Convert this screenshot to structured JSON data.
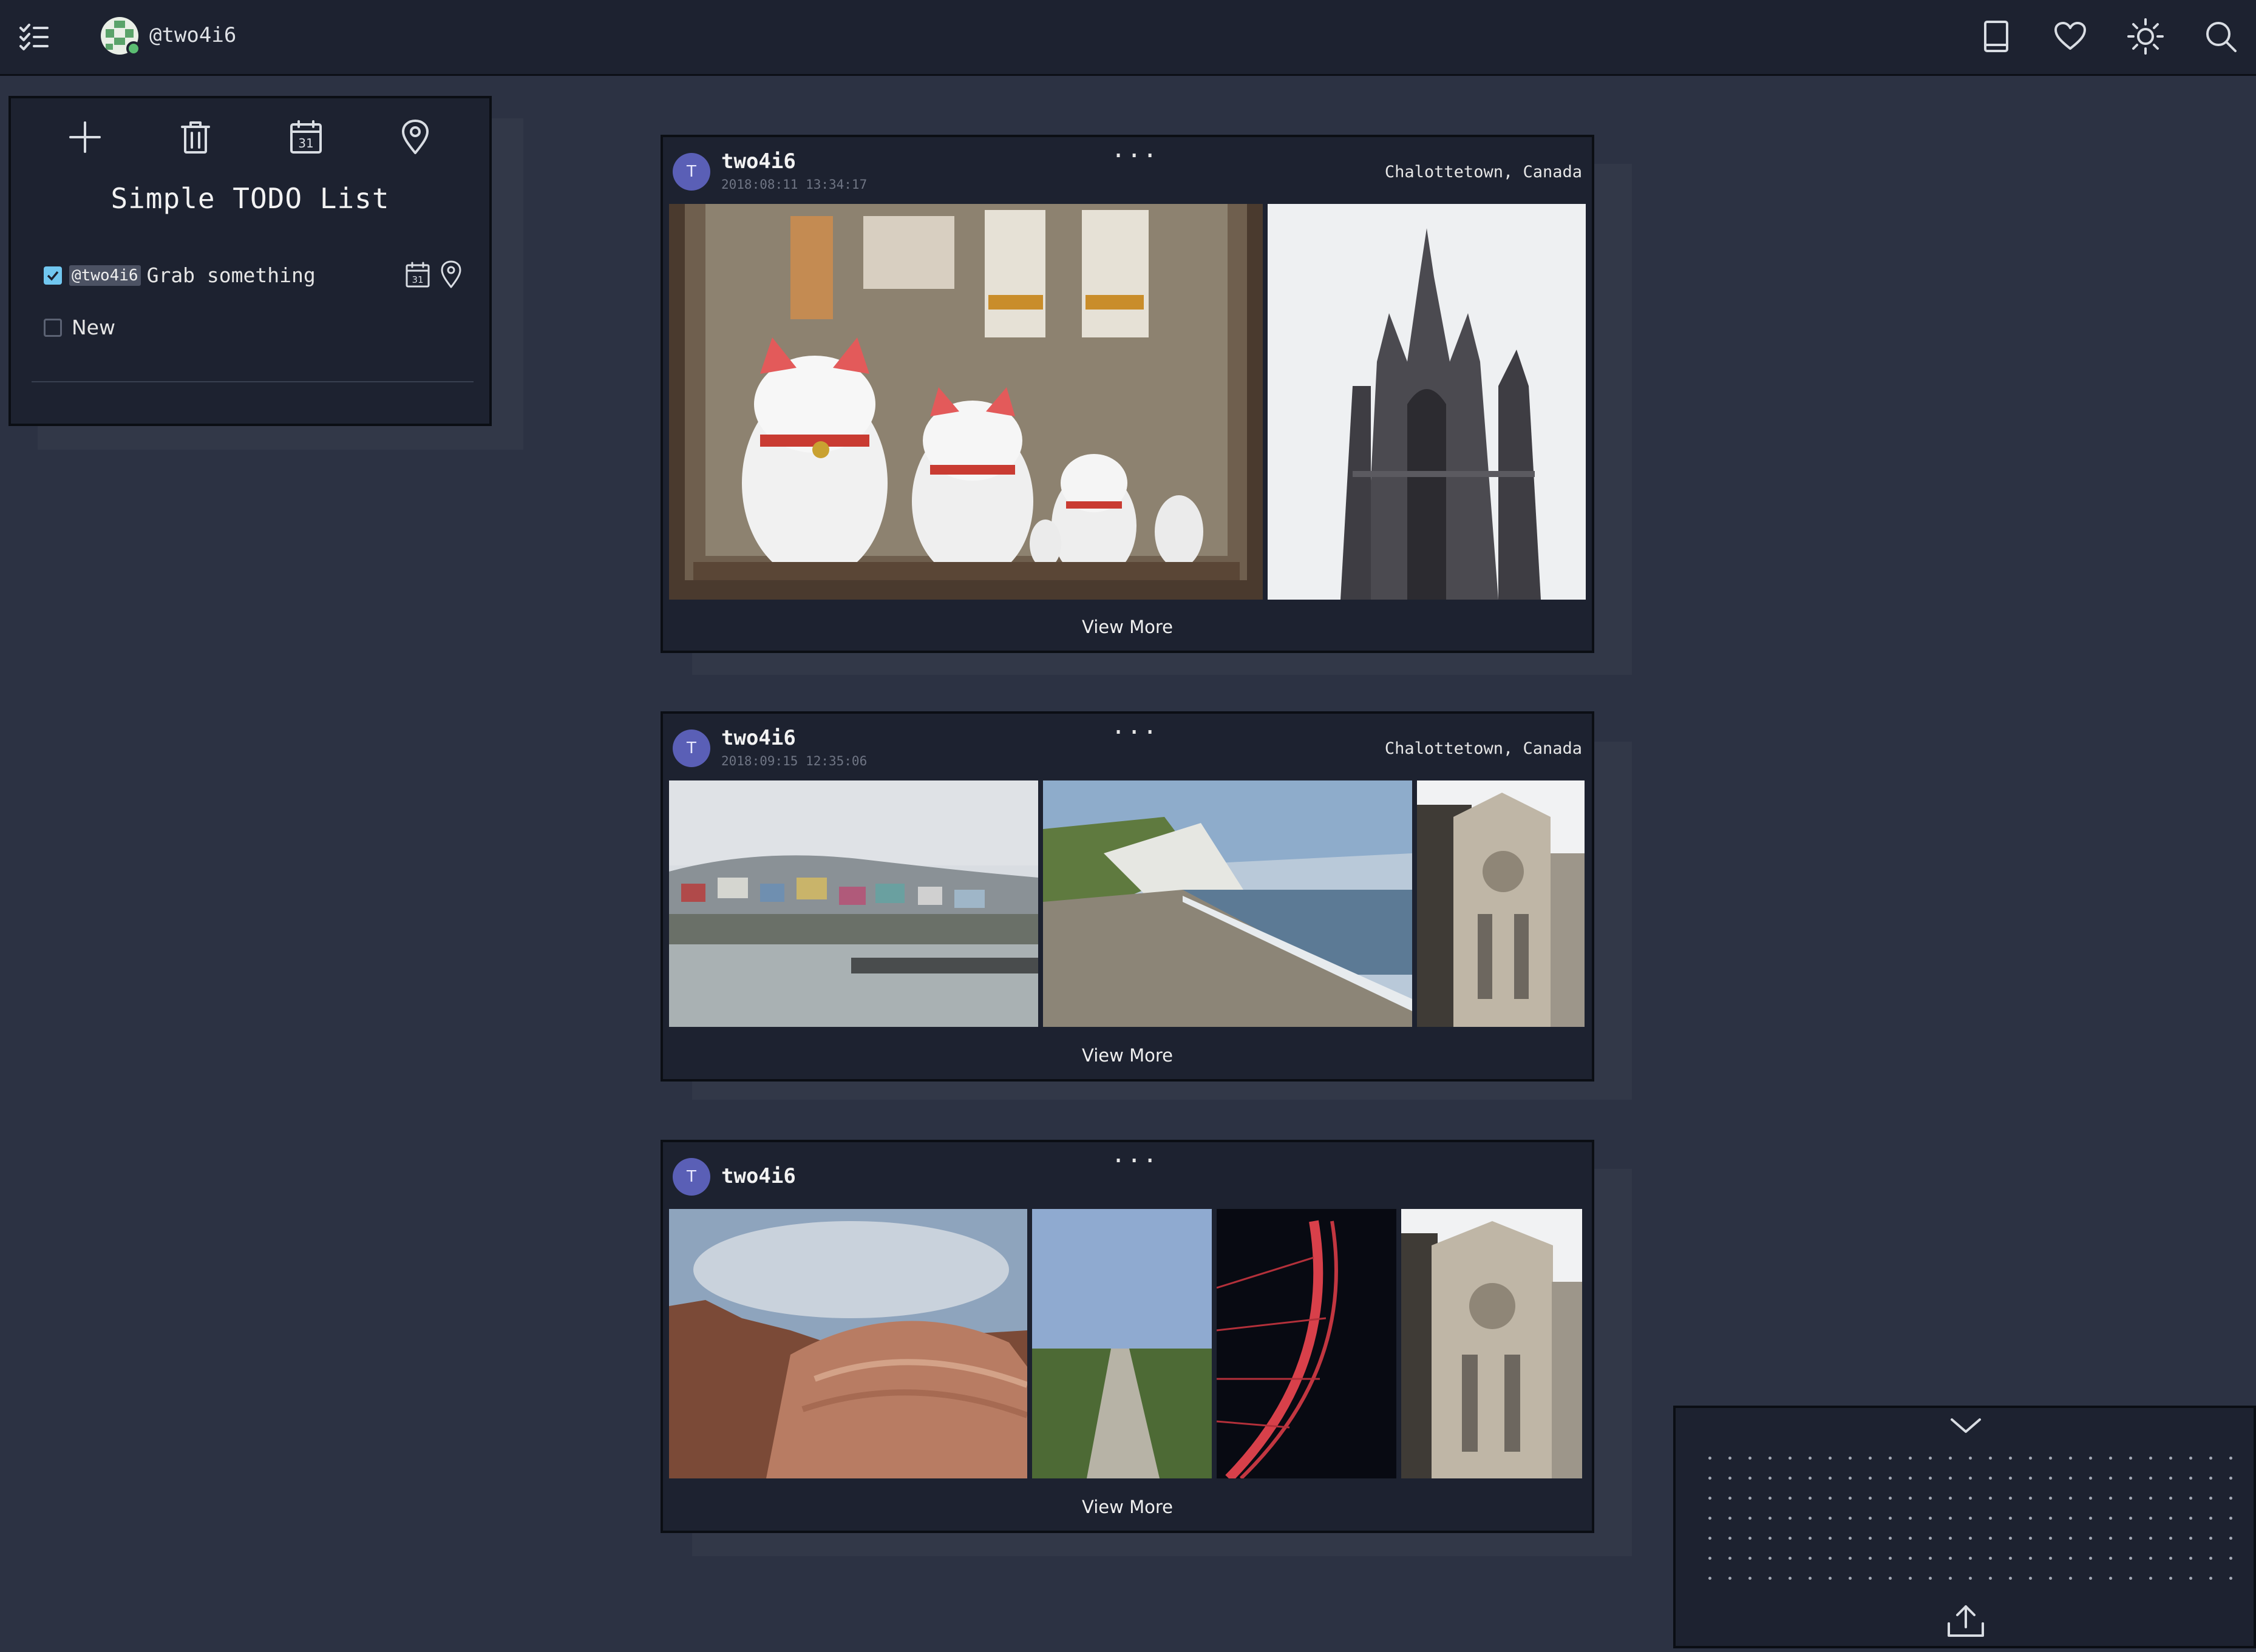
{
  "header": {
    "handle": "@two4i6",
    "icons": [
      "todo-list-icon",
      "book-icon",
      "heart-icon",
      "sun-icon",
      "search-icon"
    ]
  },
  "todo": {
    "title": "Simple TODO List",
    "toolbar_icons": [
      "plus-icon",
      "trash-icon",
      "calendar-icon",
      "map-pin-icon"
    ],
    "items": [
      {
        "tag": "@two4i6",
        "text": "Grab something",
        "checked": true
      },
      {
        "text": "New",
        "checked": false
      }
    ]
  },
  "posts": [
    {
      "avatar_letter": "T",
      "user": "two4i6",
      "time": "2018:08:11 13:34:17",
      "more": "···",
      "location": "Chalottetown, Canada",
      "images": [
        "maneki-neko-cats",
        "gothic-cathedral-tower"
      ],
      "view_more": "View More"
    },
    {
      "avatar_letter": "T",
      "user": "two4i6",
      "time": "2018:09:15 12:35:06",
      "more": "···",
      "location": "Chalottetown, Canada",
      "images": [
        "harbour-town",
        "chalk-cliffs-beach",
        "cathedral-facade"
      ],
      "view_more": "View More"
    },
    {
      "avatar_letter": "T",
      "user": "two4i6",
      "more": "···",
      "images": [
        "red-rock-desert",
        "grass-path",
        "red-ferris-wheel",
        "cathedral-facade"
      ],
      "view_more": "View More"
    }
  ],
  "drop_panel": {
    "icons": [
      "chevron-down-icon",
      "upload-icon"
    ]
  }
}
